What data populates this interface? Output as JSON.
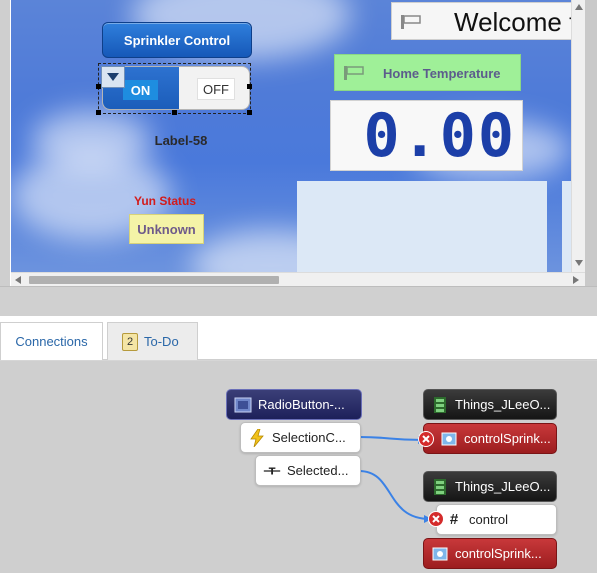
{
  "designer": {
    "sprinkler_button": "Sprinkler Control",
    "toggle": {
      "on_label": "ON",
      "off_label": "OFF",
      "selected": "ON"
    },
    "label_58": "Label-58",
    "yun_status_label": "Yun Status",
    "yun_status_value": "Unknown",
    "welcome_text": "Welcome t",
    "home_temp_label": "Home Temperature",
    "temp_value": "0.00"
  },
  "tabs": {
    "connections_label": "Connections",
    "todo_label": "To-Do",
    "todo_count": "2",
    "active": "Connections"
  },
  "connections": {
    "source_widget": "RadioButton-...",
    "source_event": "SelectionC...",
    "source_property": "Selected...",
    "thing_1": "Things_JLeeO...",
    "target_service_1": "controlSprink...",
    "thing_2": "Things_JLeeO...",
    "target_param": "control",
    "target_service_2": "controlSprink..."
  },
  "colors": {
    "accent_blue": "#1658b8",
    "status_red": "#d21b1b",
    "temp_digits": "#1c3fa8",
    "wire": "#3b82e6"
  }
}
